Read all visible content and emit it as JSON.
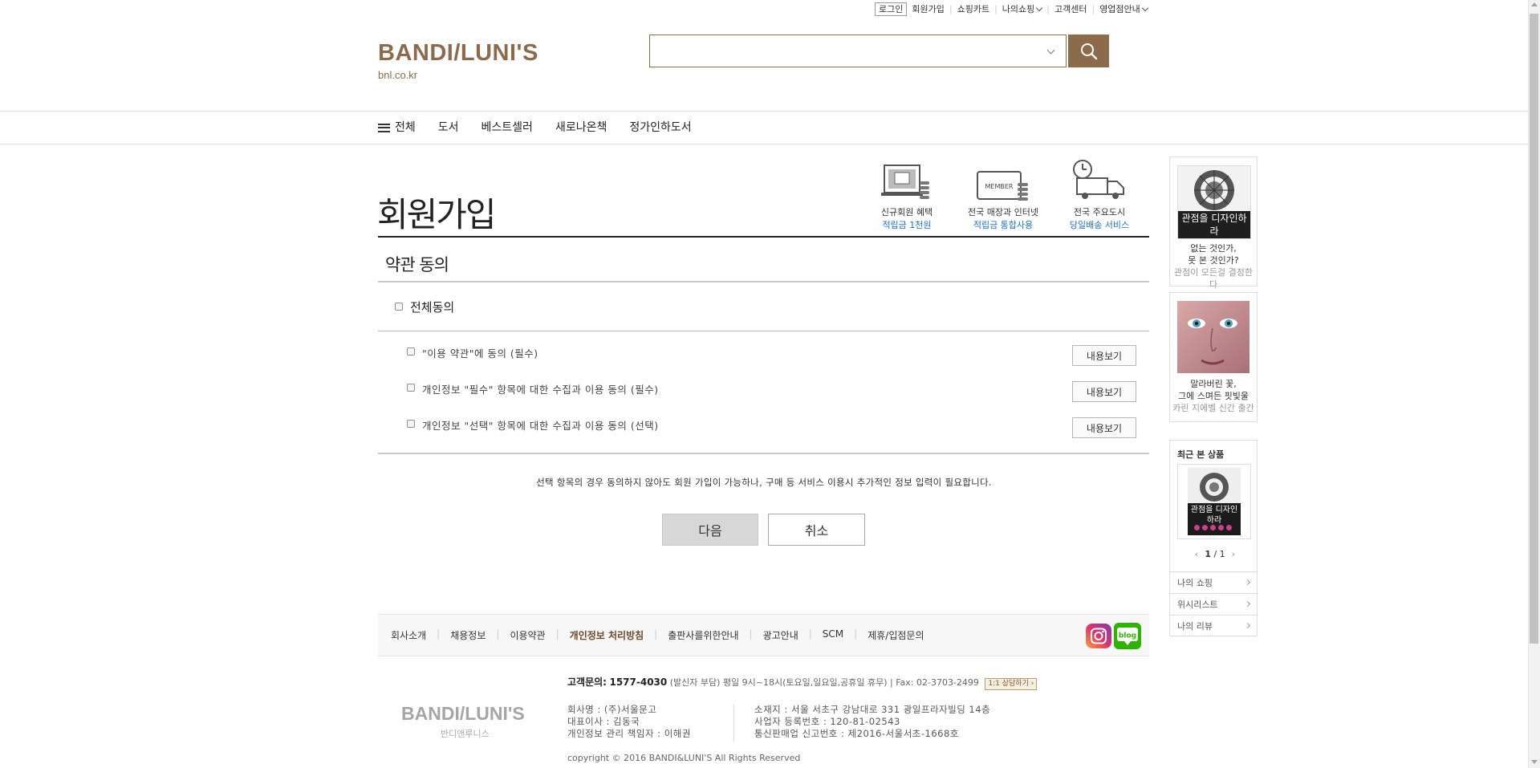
{
  "util_nav": {
    "login": "로그인",
    "signup": "회원가입",
    "cart": "쇼핑카트",
    "myshop": "나의쇼핑",
    "cs_center": "고객센터",
    "stores": "영업점안내"
  },
  "header": {
    "logo": "BANDI/LUNI'S",
    "logo_sub": "bnl.co.kr",
    "search_value": ""
  },
  "gnb": {
    "all": "전체",
    "items": [
      "도서",
      "베스트셀러",
      "새로나온책",
      "정가인하도서"
    ]
  },
  "page": {
    "title": "회원가입",
    "section_title": "약관 동의"
  },
  "benefits": [
    {
      "line1": "신규회원 혜택",
      "line2": "적립금 1천원",
      "icon": "signup-benefit-icon"
    },
    {
      "line1": "전국 매장과 인터넷",
      "line2": "적립금 통합사용",
      "icon": "member-card-icon"
    },
    {
      "line1": "전국 주요도시",
      "line2": "당일배송 서비스",
      "icon": "delivery-truck-icon"
    }
  ],
  "agreement": {
    "all_label": "전체동의",
    "terms": [
      {
        "label": "\"이용 약관\"에 동의 (필수)",
        "button": "내용보기"
      },
      {
        "label": "개인정보 \"필수\" 항목에 대한 수집과 이용 동의 (필수)",
        "button": "내용보기"
      },
      {
        "label": "개인정보 \"선택\" 항목에 대한 수집과 이용 동의 (선택)",
        "button": "내용보기"
      }
    ],
    "notice": "선택 항목의 경우 동의하지 않아도 회원 가입이 가능하나, 구매 등 서비스 이용시 추가적인 정보 입력이 필요합니다.",
    "next": "다음",
    "cancel": "취소"
  },
  "sidebar": {
    "banner1": {
      "cover_text": "관점을 디자인하라",
      "line1": "없는 것인가,",
      "line2": "못 본 것인가?",
      "line3": "관점이 모든걸 결정한다"
    },
    "banner2": {
      "line1": "말라버린 꽃,",
      "line2": "그에 스며든 핏빛울",
      "line3": "카린 지에벨 신간 출간"
    },
    "recent": {
      "title": "최근 본 상품",
      "cover_text": "관점을 디자인하라",
      "page": "1",
      "total": "1"
    },
    "links": [
      "나의 쇼핑",
      "위시리스트",
      "나의 리뷰"
    ]
  },
  "footer": {
    "links": [
      "회사소개",
      "채용정보",
      "이용약관",
      "개인정보 처리방침",
      "출판사를위한안내",
      "광고안내",
      "SCM",
      "제휴/입점문의"
    ],
    "cs_label": "고객문의:",
    "cs_phone": "1577-4030",
    "cs_hours": "(발신자 부담) 평일 9시~18시(토요일,일요일,공휴일 휴무) | Fax: 02-3703-2499",
    "cs_button": "1:1 상담하기 ›",
    "logo": "BANDI/LUNI'S",
    "logo_sub": "반디앤루니스",
    "info_left": [
      "회사명 : (주)서울문고",
      "대표이사 : 김동국",
      "개인정보 관리 책임자 : 이해권"
    ],
    "info_right": [
      "소재지 : 서울 서초구 강남대로 331 광일프라자빌딩 14층",
      "사업자 등록번호 : 120-81-02543",
      "통신판매업 신고번호 : 제2016-서울서초-1668호"
    ],
    "copyright": "copyright © 2016 BANDI&LUNI'S All Rights Reserved",
    "sns": [
      "instagram",
      "blog"
    ]
  },
  "colors": {
    "brand_brown": "#8b6b4a",
    "link_blue": "#1d6fc7",
    "button_gray": "#d7d7d7"
  }
}
